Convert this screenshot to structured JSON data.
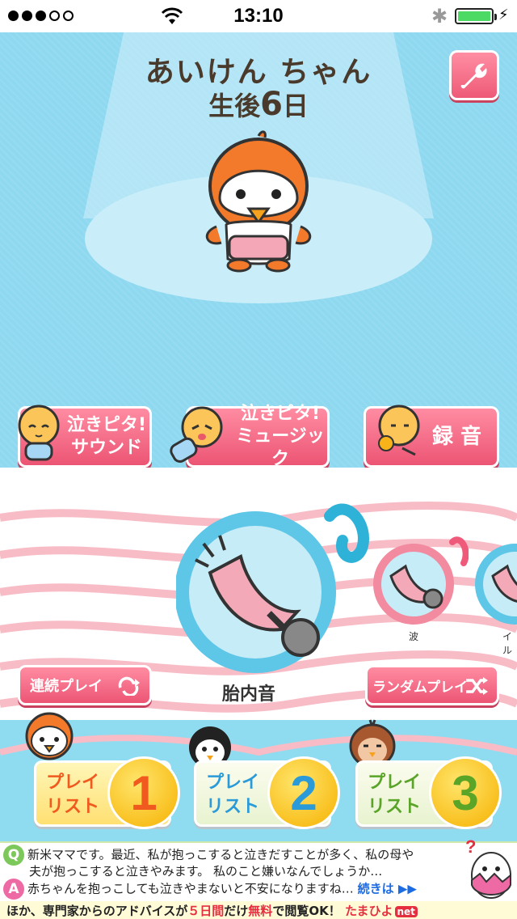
{
  "status": {
    "signal_dots": 5,
    "signal_filled": 3,
    "time": "13:10",
    "battery_level": 1.0
  },
  "baby": {
    "name": "あいけん ちゃん",
    "age_prefix": "生後",
    "age_days": "6",
    "age_suffix": "日"
  },
  "actions": {
    "cry_sound_l1": "泣きピタ!",
    "cry_sound_l2": "サウンド",
    "cry_music_l1": "泣きピタ!",
    "cry_music_l2": "ミュージック",
    "record": "録 音"
  },
  "sounds": {
    "current": "胎内音",
    "next_1": "波",
    "next_2": "イル"
  },
  "play_modes": {
    "continuous": "連続プレイ",
    "random": "ランダムプレイ"
  },
  "playlists": [
    {
      "line1": "プレイ",
      "line2": "リスト",
      "number": "1",
      "color": "#f05a1e"
    },
    {
      "line1": "プレイ",
      "line2": "リスト",
      "number": "2",
      "color": "#2a9ad8"
    },
    {
      "line1": "プレイ",
      "line2": "リスト",
      "number": "3",
      "color": "#5aa428"
    }
  ],
  "ad": {
    "q_mark": "Q",
    "question_l1": "新米ママです。最近、私が抱っこすると泣きだすことが多く、私の母や",
    "question_l2": "夫が抱っこすると泣きやみます。 私のこと嫌いなんでしょうか…",
    "a_mark": "A",
    "answer": "赤ちゃんを抱っこしても泣きやまないと不安になりますね…",
    "more": "続きは",
    "bottom_pre": "ほか、専門家からのアドバイスが",
    "bottom_days": "５日間",
    "bottom_mid": "だけ",
    "bottom_free": "無料",
    "bottom_post": "で閲覧OK！",
    "brand": "たまひよ",
    "brand_net": "net"
  },
  "colors": {
    "accent_pink": "#ec5574",
    "sky": "#8ed8f0",
    "text_brown": "#4a3a2c"
  }
}
